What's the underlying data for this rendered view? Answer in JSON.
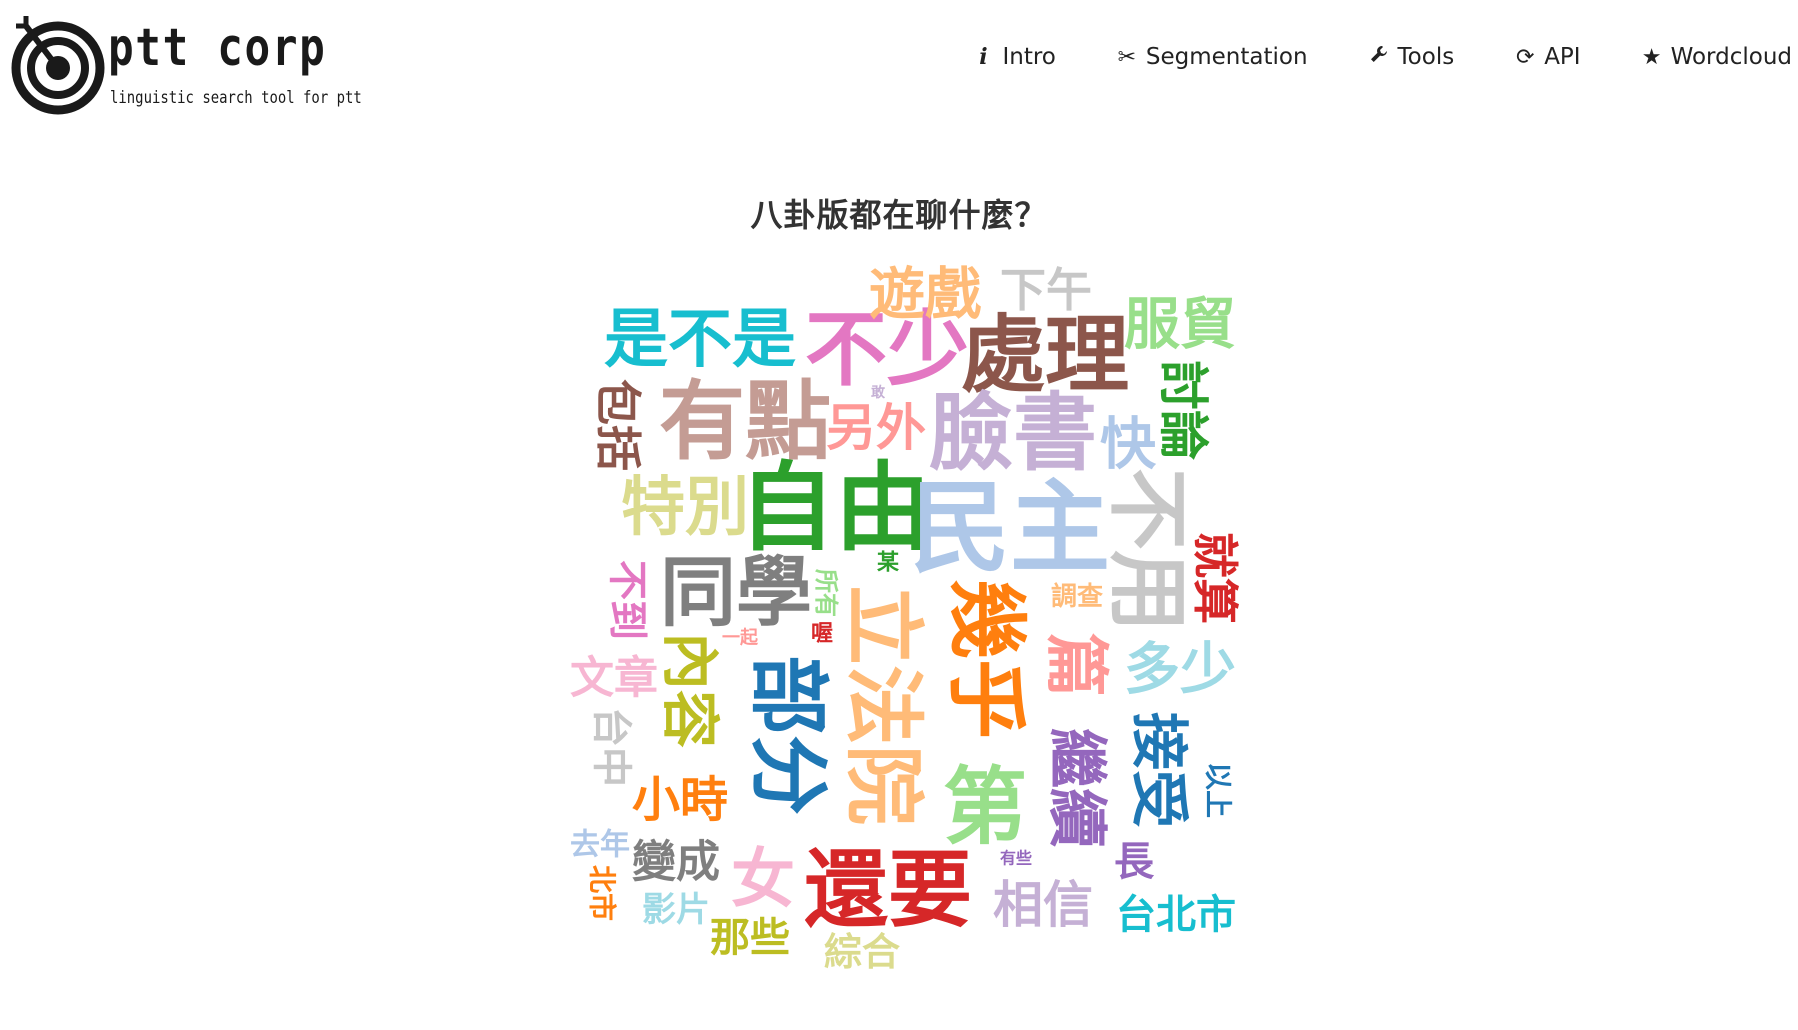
{
  "logo": {
    "name": "ptt corp",
    "tagline": "linguistic search tool for ptt"
  },
  "nav": {
    "items": [
      {
        "label": "Intro",
        "icon": "info-icon"
      },
      {
        "label": "Segmentation",
        "icon": "scissors-icon"
      },
      {
        "label": "Tools",
        "icon": "wrench-icon"
      },
      {
        "label": "API",
        "icon": "refresh-icon"
      },
      {
        "label": "Wordcloud",
        "icon": "star-icon"
      }
    ]
  },
  "page": {
    "title": "八卦版都在聊什麼？"
  },
  "wordcloud": {
    "words": [
      {
        "text": "是不是",
        "color": "#17becf"
      },
      {
        "text": "不少",
        "color": "#e377c2"
      },
      {
        "text": "處理",
        "color": "#8c564b"
      },
      {
        "text": "遊戲",
        "color": "#ffbb78"
      },
      {
        "text": "下午",
        "color": "#c7c7c7"
      },
      {
        "text": "服貿",
        "color": "#98df8a"
      },
      {
        "text": "包括",
        "color": "#8c564b"
      },
      {
        "text": "有點",
        "color": "#c49c94"
      },
      {
        "text": "敢",
        "color": "#c5b0d5"
      },
      {
        "text": "另外",
        "color": "#ff9896"
      },
      {
        "text": "臉書",
        "color": "#c5b0d5"
      },
      {
        "text": "快",
        "color": "#aec7e8"
      },
      {
        "text": "討論",
        "color": "#2ca02c"
      },
      {
        "text": "特別",
        "color": "#dbdb8d"
      },
      {
        "text": "自由",
        "color": "#2ca02c"
      },
      {
        "text": "民主",
        "color": "#aec7e8"
      },
      {
        "text": "不用",
        "color": "#c7c7c7"
      },
      {
        "text": "就算",
        "color": "#d62728"
      },
      {
        "text": "不到",
        "color": "#e377c2"
      },
      {
        "text": "同學",
        "color": "#7f7f7f"
      },
      {
        "text": "所有",
        "color": "#98df8a"
      },
      {
        "text": "某",
        "color": "#2ca02c"
      },
      {
        "text": "立法院",
        "color": "#ffbb78"
      },
      {
        "text": "幾乎",
        "color": "#ff7f0e"
      },
      {
        "text": "調查",
        "color": "#ffbb78"
      },
      {
        "text": "篇",
        "color": "#ff9896"
      },
      {
        "text": "多少",
        "color": "#9edae5"
      },
      {
        "text": "一起",
        "color": "#ff9896"
      },
      {
        "text": "喔",
        "color": "#d62728"
      },
      {
        "text": "內容",
        "color": "#bcbd22"
      },
      {
        "text": "部分",
        "color": "#1f77b4"
      },
      {
        "text": "文章",
        "color": "#f7b6d2"
      },
      {
        "text": "台中",
        "color": "#c7c7c7"
      },
      {
        "text": "繼續",
        "color": "#9467bd"
      },
      {
        "text": "接受",
        "color": "#1f77b4"
      },
      {
        "text": "以上",
        "color": "#1f77b4"
      },
      {
        "text": "第",
        "color": "#98df8a"
      },
      {
        "text": "小時",
        "color": "#ff7f0e"
      },
      {
        "text": "去年",
        "color": "#aec7e8"
      },
      {
        "text": "變成",
        "color": "#7f7f7f"
      },
      {
        "text": "女",
        "color": "#f7b6d2"
      },
      {
        "text": "還要",
        "color": "#d62728"
      },
      {
        "text": "有些",
        "color": "#9467bd"
      },
      {
        "text": "長",
        "color": "#9467bd"
      },
      {
        "text": "北市",
        "color": "#ff7f0e"
      },
      {
        "text": "影片",
        "color": "#9edae5"
      },
      {
        "text": "相信",
        "color": "#c5b0d5"
      },
      {
        "text": "台北市",
        "color": "#17becf"
      },
      {
        "text": "那些",
        "color": "#bcbd22"
      },
      {
        "text": "綜合",
        "color": "#dbdb8d"
      }
    ]
  }
}
